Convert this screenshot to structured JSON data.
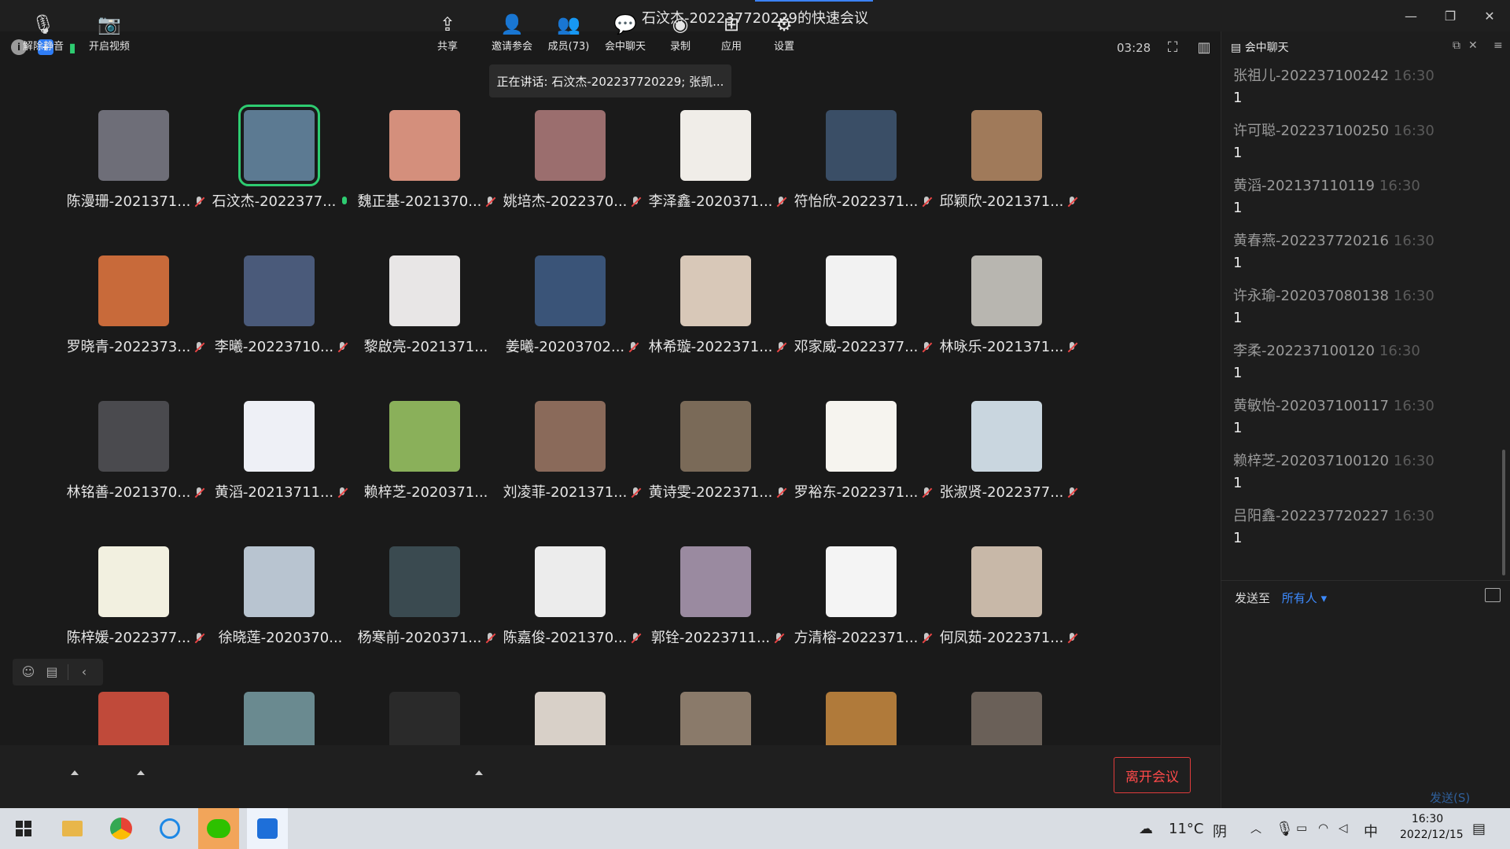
{
  "window": {
    "title": "石汶杰-202237720229的快速会议",
    "controls": {
      "minimize": "—",
      "restore": "❐",
      "close": "✕"
    }
  },
  "meeting": {
    "timer": "03:28",
    "speaking": "正在讲话: 石汶杰-202237720229; 张凯..."
  },
  "participants": [
    {
      "name": "陈漫珊-2021371...",
      "mic": "muted",
      "color": "#6e6e78"
    },
    {
      "name": "石汶杰-2022377...",
      "mic": "live",
      "color": "#5c7a92",
      "active": true
    },
    {
      "name": "魏正基-2021370...",
      "mic": "muted",
      "color": "#d48f7c"
    },
    {
      "name": "姚培杰-2022370...",
      "mic": "muted",
      "color": "#9b6e6e"
    },
    {
      "name": "李泽鑫-2020371...",
      "mic": "muted",
      "color": "#f0ede8"
    },
    {
      "name": "符怡欣-2022371...",
      "mic": "muted",
      "color": "#3a4e66"
    },
    {
      "name": "邱颖欣-2021371...",
      "mic": "muted",
      "color": "#a07a5a"
    },
    {
      "name": "罗晓青-2022373...",
      "mic": "muted",
      "color": "#c86a3a"
    },
    {
      "name": "李曦-20223710...",
      "mic": "muted",
      "color": "#4a5a7a"
    },
    {
      "name": "黎啟亮-2021371...",
      "mic": "none",
      "color": "#e8e6e6"
    },
    {
      "name": "姜曦-20203702...",
      "mic": "muted",
      "color": "#3a5478"
    },
    {
      "name": "林希璇-2022371...",
      "mic": "muted",
      "color": "#d8c8b8"
    },
    {
      "name": "邓家威-2022377...",
      "mic": "muted",
      "color": "#f2f2f2"
    },
    {
      "name": "林咏乐-2021371...",
      "mic": "muted",
      "color": "#b8b6b0"
    },
    {
      "name": "林铭善-2021370...",
      "mic": "muted",
      "color": "#4a4a4e"
    },
    {
      "name": "黄滔-20213711...",
      "mic": "muted",
      "color": "#eef0f6"
    },
    {
      "name": "赖梓芝-2020371...",
      "mic": "none",
      "color": "#8ab05a"
    },
    {
      "name": "刘凌菲-2021371...",
      "mic": "muted",
      "color": "#8a6a5a"
    },
    {
      "name": "黄诗雯-2022371...",
      "mic": "muted",
      "color": "#7a6a58"
    },
    {
      "name": "罗裕东-2022371...",
      "mic": "muted",
      "color": "#f6f4ef"
    },
    {
      "name": "张淑贤-2022377...",
      "mic": "muted",
      "color": "#c9d6df"
    },
    {
      "name": "陈梓媛-2022377...",
      "mic": "muted",
      "color": "#f2f0e0"
    },
    {
      "name": "徐晓莲-2020370...",
      "mic": "none",
      "color": "#b8c4d0"
    },
    {
      "name": "杨寒前-2020371...",
      "mic": "muted",
      "color": "#3a4a50"
    },
    {
      "name": "陈嘉俊-2021370...",
      "mic": "muted",
      "color": "#ececec"
    },
    {
      "name": "郭铨-20223711...",
      "mic": "muted",
      "color": "#9a8aa0"
    },
    {
      "name": "方清榕-2022371...",
      "mic": "muted",
      "color": "#f4f4f4"
    },
    {
      "name": "何凤茹-2022371...",
      "mic": "muted",
      "color": "#c8b8a8"
    },
    {
      "name": "",
      "mic": "none",
      "color": "#c04a3a"
    },
    {
      "name": "",
      "mic": "none",
      "color": "#6a8a90"
    },
    {
      "name": "",
      "mic": "none",
      "color": "#2a2a2a"
    },
    {
      "name": "",
      "mic": "none",
      "color": "#d8d0c8"
    },
    {
      "name": "",
      "mic": "none",
      "color": "#8a7a6a"
    },
    {
      "name": "",
      "mic": "none",
      "color": "#b07a3a"
    },
    {
      "name": "",
      "mic": "none",
      "color": "#6a6058"
    }
  ],
  "toolbar": {
    "unmute": "解除静音",
    "start_video": "开启视频",
    "share": "共享",
    "invite": "邀请参会",
    "members": "成员(73)",
    "chat": "会中聊天",
    "record": "录制",
    "apps": "应用",
    "settings": "设置",
    "leave": "离开会议"
  },
  "chat": {
    "title": "会中聊天",
    "messages": [
      {
        "sender": "张祖儿-202237100242",
        "time": "16:30",
        "text": "1"
      },
      {
        "sender": "许可聪-202237100250",
        "time": "16:30",
        "text": "1"
      },
      {
        "sender": "黄滔-202137110119",
        "time": "16:30",
        "text": "1"
      },
      {
        "sender": "黄春燕-202237720216",
        "time": "16:30",
        "text": "1"
      },
      {
        "sender": "许永瑜-202037080138",
        "time": "16:30",
        "text": "1"
      },
      {
        "sender": "李柔-202237100120",
        "time": "16:30",
        "text": "1"
      },
      {
        "sender": "黄敏怡-202037100117",
        "time": "16:30",
        "text": "1"
      },
      {
        "sender": "赖梓芝-202037100120",
        "time": "16:30",
        "text": "1"
      },
      {
        "sender": "吕阳鑫-202237720227",
        "time": "16:30",
        "text": "1"
      }
    ],
    "send_to_label": "发送至",
    "send_to_target": "所有人 ▾",
    "send_button": "发送(S)"
  },
  "taskbar": {
    "weather_temp": "11°C",
    "weather_desc": "阴",
    "ime": "中",
    "time": "16:30",
    "date": "2022/12/15"
  }
}
